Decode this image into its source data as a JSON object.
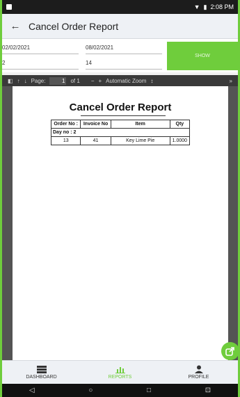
{
  "status": {
    "time": "2:08 PM"
  },
  "appbar": {
    "title": "Cancel Order Report"
  },
  "form": {
    "from_date": "02/02/2021",
    "to_date": "08/02/2021",
    "field_a": "2",
    "field_b": "14",
    "show_label": "SHOW"
  },
  "pdf": {
    "page_label": "Page:",
    "page_value": "1",
    "page_total": "of 1",
    "zoom_label": "Automatic Zoom"
  },
  "report": {
    "title": "Cancel Order Report",
    "columns": [
      "Order No :",
      "Invoice No",
      "Item",
      "Qty"
    ],
    "group_label": "Day no : 2",
    "rows": [
      {
        "order": "13",
        "invoice": "41",
        "item": "Key Lime Pie",
        "qty": "1.0000"
      }
    ]
  },
  "nav": {
    "dashboard": "DASHBOARD",
    "reports": "REPORTS",
    "profile": "PROFILE"
  },
  "colors": {
    "accent": "#6fcd3c"
  }
}
